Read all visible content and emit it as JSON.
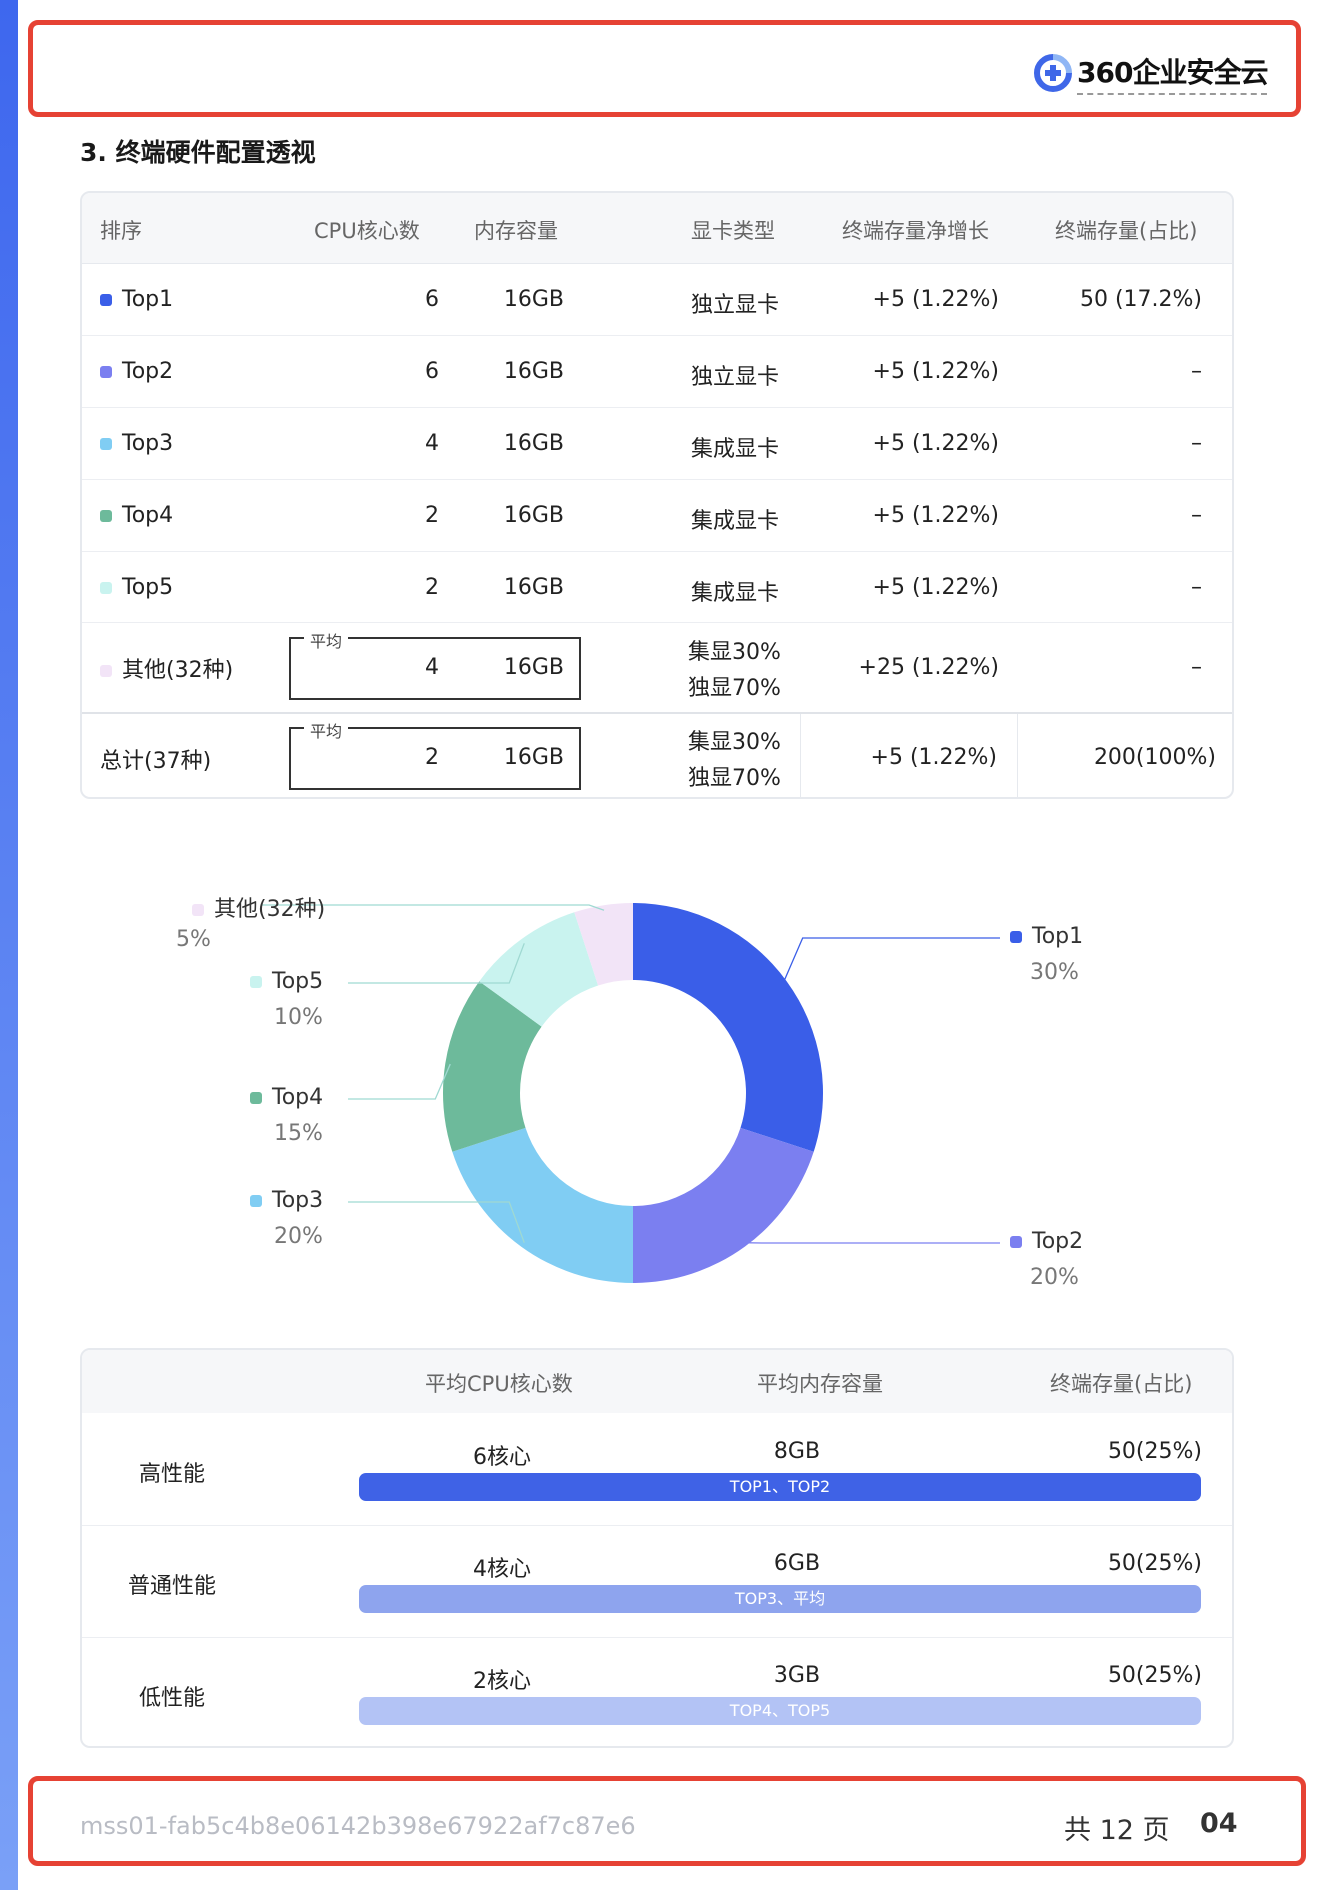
{
  "brand": {
    "logo_text": "360企业安全云"
  },
  "section_title": "3. 终端硬件配置透视",
  "table1": {
    "headers": [
      "排序",
      "CPU核心数",
      "内存容量",
      "显卡类型",
      "终端存量净增长",
      "终端存量(占比)"
    ],
    "rows": [
      {
        "name": "Top1",
        "color": "#3a5ee8",
        "cpu": "6",
        "mem": "16GB",
        "gpu": "独立显卡",
        "growth": "+5 (1.22%)",
        "stock": "50 (17.2%)"
      },
      {
        "name": "Top2",
        "color": "#7b7ff0",
        "cpu": "6",
        "mem": "16GB",
        "gpu": "独立显卡",
        "growth": "+5 (1.22%)",
        "stock": "–"
      },
      {
        "name": "Top3",
        "color": "#80cdf3",
        "cpu": "4",
        "mem": "16GB",
        "gpu": "集成显卡",
        "growth": "+5 (1.22%)",
        "stock": "–"
      },
      {
        "name": "Top4",
        "color": "#6dba9b",
        "cpu": "2",
        "mem": "16GB",
        "gpu": "集成显卡",
        "growth": "+5 (1.22%)",
        "stock": "–"
      },
      {
        "name": "Top5",
        "color": "#c9f3ef",
        "cpu": "2",
        "mem": "16GB",
        "gpu": "集成显卡",
        "growth": "+5 (1.22%)",
        "stock": "–"
      }
    ],
    "other": {
      "name": "其他(32种)",
      "color": "#f2e4f7",
      "avg_label": "平均",
      "cpu": "4",
      "mem": "16GB",
      "gpu_line1": "集显30%",
      "gpu_line2": "独显70%",
      "growth": "+25 (1.22%)",
      "stock": "–"
    },
    "total": {
      "name": "总计(37种)",
      "avg_label": "平均",
      "cpu": "2",
      "mem": "16GB",
      "gpu_line1": "集显30%",
      "gpu_line2": "独显70%",
      "growth": "+5 (1.22%)",
      "stock": "200(100%)"
    }
  },
  "chart_data": {
    "type": "pie",
    "donut": true,
    "categories": [
      "Top1",
      "Top2",
      "Top3",
      "Top4",
      "Top5",
      "其他(32种)"
    ],
    "values": [
      30,
      20,
      20,
      15,
      10,
      5
    ],
    "labels": [
      "30%",
      "20%",
      "20%",
      "15%",
      "10%",
      "5%"
    ],
    "colors": [
      "#3a5ee8",
      "#7b7ff0",
      "#80cdf3",
      "#6dba9b",
      "#c9f3ef",
      "#f2e4f7"
    ]
  },
  "table2": {
    "headers": [
      "平均CPU核心数",
      "平均内存容量",
      "终端存量(占比)"
    ],
    "rows": [
      {
        "name": "高性能",
        "cpu": "6核心",
        "mem": "8GB",
        "stock": "50(25%)",
        "bar_label": "TOP1、TOP2",
        "bar_color": "#3f62e6"
      },
      {
        "name": "普通性能",
        "cpu": "4核心",
        "mem": "6GB",
        "stock": "50(25%)",
        "bar_label": "TOP3、平均",
        "bar_color": "#8ea4ee"
      },
      {
        "name": "低性能",
        "cpu": "2核心",
        "mem": "3GB",
        "stock": "50(25%)",
        "bar_label": "TOP4、TOP5",
        "bar_color": "#b3c3f5"
      }
    ]
  },
  "footer": {
    "doc_id": "mss01-fab5c4b8e06142b398e67922af7c87e6",
    "pages_text": "共 12 页",
    "page_num": "04"
  }
}
